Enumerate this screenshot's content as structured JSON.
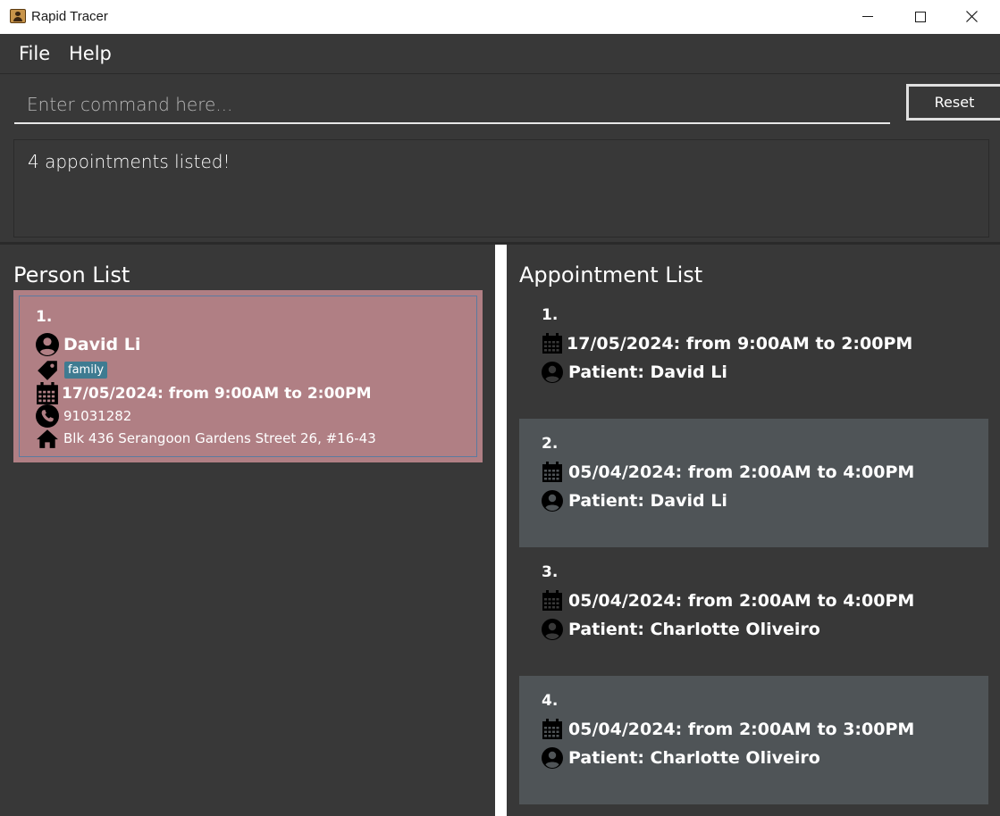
{
  "window": {
    "title": "Rapid Tracer"
  },
  "menu": {
    "file": "File",
    "help": "Help"
  },
  "command": {
    "placeholder": "Enter command here...",
    "reset_label": "Reset"
  },
  "result": {
    "message": "4 appointments listed!"
  },
  "person_list": {
    "title": "Person List",
    "persons": [
      {
        "index": "1.",
        "name": "David Li",
        "tag": "family",
        "appointment": "17/05/2024: from 9:00AM to 2:00PM",
        "phone": "91031282",
        "address": "Blk 436 Serangoon Gardens Street 26, #16-43"
      }
    ]
  },
  "appointment_list": {
    "title": "Appointment List",
    "appointments": [
      {
        "index": "1.",
        "time": "17/05/2024: from 9:00AM to 2:00PM",
        "patient": "Patient: David Li"
      },
      {
        "index": "2.",
        "time": "05/04/2024: from 2:00AM to 4:00PM",
        "patient": "Patient: David Li"
      },
      {
        "index": "3.",
        "time": "05/04/2024: from 2:00AM to 4:00PM",
        "patient": "Patient: Charlotte Oliveiro"
      },
      {
        "index": "4.",
        "time": "05/04/2024: from 2:00AM to 3:00PM",
        "patient": "Patient: Charlotte Oliveiro"
      }
    ]
  },
  "colors": {
    "background": "#383838",
    "selected_card": "#b07f84",
    "tag": "#3e7b91",
    "alt_row": "#4f5457"
  }
}
